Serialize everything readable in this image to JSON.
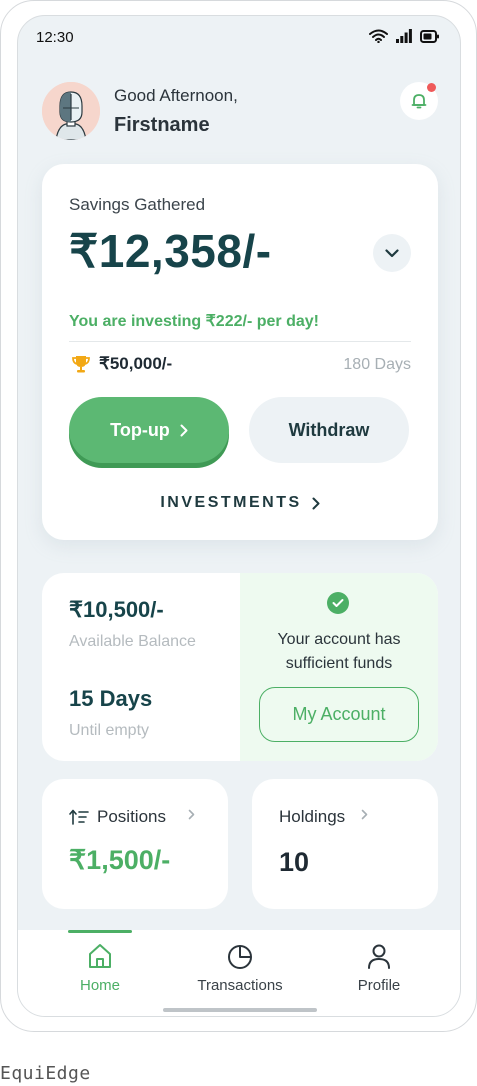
{
  "status_bar": {
    "time": "12:30"
  },
  "header": {
    "greeting": "Good Afternoon,",
    "name": "Firstname"
  },
  "savings": {
    "label": "Savings Gathered",
    "amount": "₹12,358/-",
    "investing_text": "You are investing ₹222/- per day!",
    "goal_amount": "₹50,000/-",
    "goal_duration": "180 Days",
    "topup_label": "Top-up",
    "withdraw_label": "Withdraw",
    "investments_label": "INVESTMENTS"
  },
  "balance": {
    "available_amount": "₹10,500/-",
    "available_label": "Available Balance",
    "days_value": "15 Days",
    "days_label": "Until empty",
    "funds_message": "Your account has sufficient funds",
    "my_account_label": "My Account"
  },
  "positions": {
    "title": "Positions",
    "value": "₹1,500/-"
  },
  "holdings": {
    "title": "Holdings",
    "value": "10"
  },
  "nav": {
    "items": [
      {
        "label": "Home",
        "icon": "home-icon",
        "active": true
      },
      {
        "label": "Transactions",
        "icon": "pie-chart-icon",
        "active": false
      },
      {
        "label": "Profile",
        "icon": "user-icon",
        "active": false
      }
    ]
  },
  "colors": {
    "accent": "#4caf65",
    "primary_text": "#17444a",
    "background": "#edf2f5",
    "notification": "#ef5a5a"
  },
  "caption": "EquiEdge"
}
